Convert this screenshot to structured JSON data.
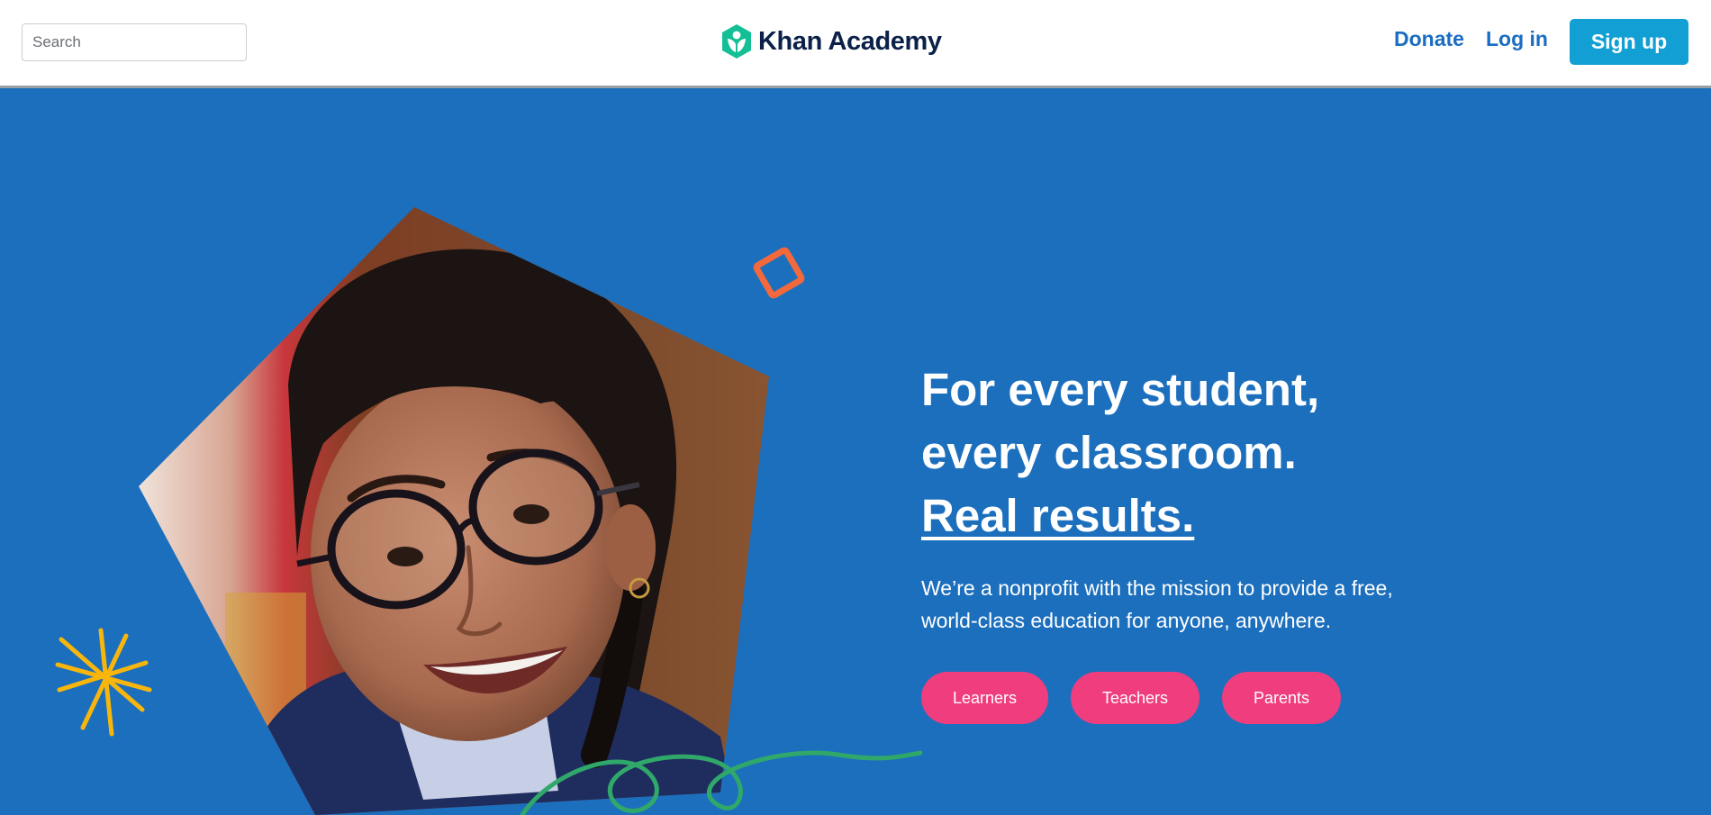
{
  "header": {
    "search": {
      "placeholder": "Search",
      "value": ""
    },
    "logo": {
      "text": "Khan Academy",
      "icon": "khan-academy-leaf-icon"
    },
    "nav": {
      "donate": "Donate",
      "login": "Log in",
      "signup": "Sign up"
    }
  },
  "hero": {
    "headline": {
      "line1": "For every student,",
      "line2": "every classroom.",
      "line3": "Real results."
    },
    "mission": "We’re a nonprofit with the mission to provide a free, world-class education for anyone, anywhere.",
    "audience_buttons": [
      "Learners",
      "Teachers",
      "Parents"
    ]
  },
  "colors": {
    "hero_background": "#1c6fbd",
    "signup_button": "#12a0d4",
    "pill_button": "#f03d7e",
    "nav_link": "#1b6dc1",
    "logo_green": "#14bf96",
    "logo_text": "#0b2149",
    "decoration_orange": "#f3693b",
    "decoration_yellow": "#f8b60c",
    "decoration_green": "#2fa86a"
  }
}
